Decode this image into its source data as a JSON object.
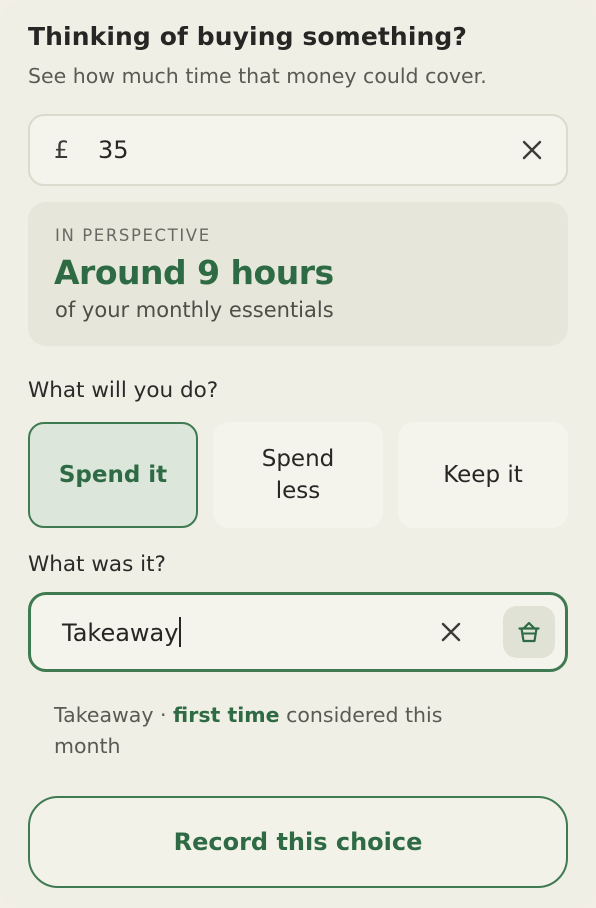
{
  "header": {
    "title": "Thinking of buying something?",
    "subtitle": "See how much time that money could cover."
  },
  "amount": {
    "currency_symbol": "£",
    "value": "35",
    "clear_icon": "close-icon"
  },
  "perspective": {
    "label": "IN PERSPECTIVE",
    "value": "Around 9 hours",
    "caption": "of your monthly essentials"
  },
  "decision": {
    "question": "What will you do?",
    "options": [
      {
        "label": "Spend it",
        "selected": true
      },
      {
        "label": "Spend less",
        "selected": false
      },
      {
        "label": "Keep it",
        "selected": false
      }
    ]
  },
  "item": {
    "question": "What was it?",
    "value": "Takeaway",
    "clear_icon": "close-icon",
    "category_icon": "takeaway-container-icon"
  },
  "note": {
    "item": "Takeaway",
    "separator": " · ",
    "highlight": "first time",
    "rest": " considered this month"
  },
  "record_button": {
    "label": "Record this choice"
  },
  "colors": {
    "accent": "#2e6b45",
    "accent_border": "#3f7a52",
    "selected_bg": "#dce6db",
    "card_bg": "#f0efe5",
    "panel_bg": "#e6e6da"
  }
}
